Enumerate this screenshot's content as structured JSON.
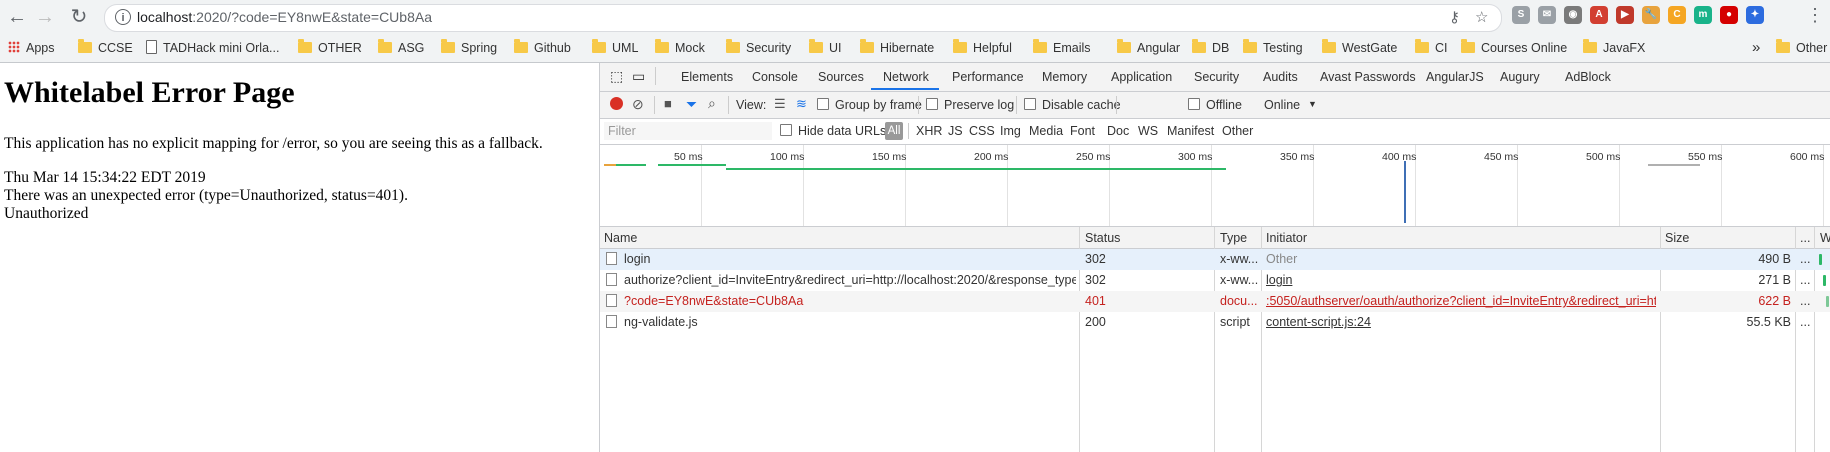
{
  "browser": {
    "url_host": "localhost",
    "url_rest": ":2020/?code=EY8nwE&state=CUb8Aa",
    "back": "←",
    "forward": "→",
    "reload": "↻",
    "info": "i",
    "key_icon": "key-icon",
    "star_icon": "star-icon",
    "extensions": [
      {
        "label": "S",
        "color": "#9aa0a6"
      },
      {
        "label": "✉",
        "color": "#9aa0a6"
      },
      {
        "label": "◉",
        "color": "#7a7a7a"
      },
      {
        "label": "A",
        "color": "#d23f31"
      },
      {
        "label": "▶",
        "color": "#c0392b"
      },
      {
        "label": "🔧",
        "color": "#e8a33d"
      },
      {
        "label": "C",
        "color": "#f5a623"
      },
      {
        "label": "m",
        "color": "#19b38a"
      },
      {
        "label": "●",
        "color": "#d50000"
      },
      {
        "label": "✦",
        "color": "#2d6cdf"
      }
    ],
    "menu": "⋮"
  },
  "bookmarks": {
    "items": [
      "Apps",
      "CCSE",
      "TADHack mini Orla...",
      "OTHER",
      "ASG",
      "Spring",
      "Github",
      "UML",
      "Mock",
      "Security",
      "UI",
      "Hibernate",
      "Helpful",
      "Emails",
      "Angular",
      "DB",
      "Testing",
      "WestGate",
      "CI",
      "Courses Online",
      "JavaFX"
    ],
    "overflow": "»",
    "other": "Other"
  },
  "page": {
    "title": "Whitelabel Error Page",
    "line1": "This application has no explicit mapping for /error, so you are seeing this as a fallback.",
    "line2": "Thu Mar 14 15:34:22 EDT 2019",
    "line3": "There was an unexpected error (type=Unauthorized, status=401).",
    "line4": "Unauthorized"
  },
  "devtools": {
    "tabs": [
      "Elements",
      "Console",
      "Sources",
      "Network",
      "Performance",
      "Memory",
      "Application",
      "Security",
      "Audits",
      "Avast Passwords",
      "AngularJS",
      "Augury",
      "AdBlock"
    ],
    "active_tab": "Network",
    "toolbar": {
      "view_label": "View:",
      "group_by_frame": "Group by frame",
      "preserve_log": "Preserve log",
      "disable_cache": "Disable cache",
      "offline": "Offline",
      "throttle": "Online",
      "throttle_caret": "▼"
    },
    "filter": {
      "placeholder": "Filter",
      "hide_data_urls": "Hide data URLs",
      "all": "All",
      "types": [
        "XHR",
        "JS",
        "CSS",
        "Img",
        "Media",
        "Font",
        "Doc",
        "WS",
        "Manifest",
        "Other"
      ]
    },
    "timeline_ticks": [
      "50 ms",
      "100 ms",
      "150 ms",
      "200 ms",
      "250 ms",
      "300 ms",
      "350 ms",
      "400 ms",
      "450 ms",
      "500 ms",
      "550 ms",
      "600 ms"
    ],
    "columns": {
      "name": "Name",
      "status": "Status",
      "type": "Type",
      "initiator": "Initiator",
      "size": "Size",
      "more": "...",
      "waterfall": "W"
    },
    "rows": [
      {
        "name": "login",
        "status": "302",
        "type": "x-ww...",
        "initiator": "Other",
        "size": "490 B",
        "more": "..."
      },
      {
        "name": "authorize?client_id=InviteEntry&redirect_uri=http://localhost:2020/&response_type...",
        "status": "302",
        "type": "x-ww...",
        "initiator": "login",
        "size": "271 B",
        "more": "..."
      },
      {
        "name": "?code=EY8nwE&state=CUb8Aa",
        "status": "401",
        "type": "docu...",
        "initiator": ":5050/authserver/oauth/authorize?client_id=InviteEntry&redirect_uri=ht...",
        "size": "622 B",
        "more": "..."
      },
      {
        "name": "ng-validate.js",
        "status": "200",
        "type": "script",
        "initiator": "content-script.js:24",
        "size": "55.5 KB",
        "more": "..."
      }
    ]
  }
}
